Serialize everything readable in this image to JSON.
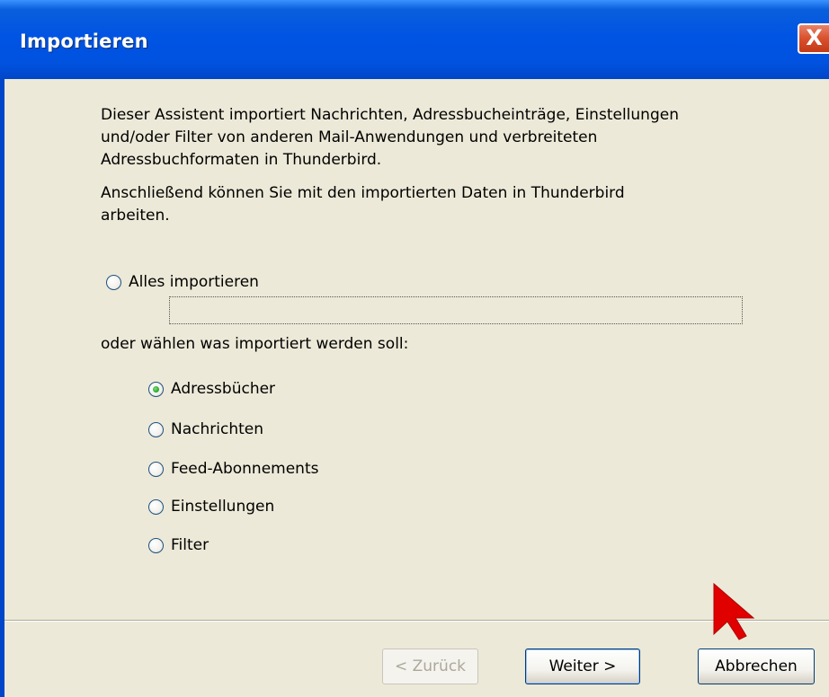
{
  "window": {
    "title": "Importieren",
    "close_label": "X"
  },
  "intro": {
    "line1": "Dieser Assistent importiert Nachrichten, Adressbucheinträge, Einstellungen",
    "line2": "und/oder Filter von anderen Mail-Anwendungen und verbreiteten",
    "line3": "Adressbuchformaten in Thunderbird.",
    "line4": "Anschließend können Sie mit den importierten Daten in Thunderbird",
    "line5": "arbeiten."
  },
  "import_all": {
    "label": "Alles importieren",
    "checked": false
  },
  "choose_label": "oder wählen was importiert werden soll:",
  "options": [
    {
      "label": "Adressbücher",
      "checked": true
    },
    {
      "label": "Nachrichten",
      "checked": false
    },
    {
      "label": "Feed-Abonnements",
      "checked": false
    },
    {
      "label": "Einstellungen",
      "checked": false
    },
    {
      "label": "Filter",
      "checked": false
    }
  ],
  "buttons": {
    "back": "< Zurück",
    "next": "Weiter >",
    "cancel": "Abbrechen"
  },
  "colors": {
    "titlebar": "#0054E3",
    "dialog_bg": "#ECE9D8",
    "close_button": "#D9502C",
    "cursor": "#E00000"
  }
}
